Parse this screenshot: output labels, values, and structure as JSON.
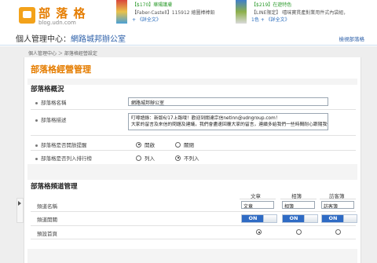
{
  "header": {
    "logo_title": "部 落 格",
    "logo_sub": "blog.udn.com",
    "ads": [
      {
        "t1": "【$170】華陽護膚",
        "t2": "【Faber-Castell】115912 繪圖棒棒鉛",
        "t3": "+ 《詳全文》"
      },
      {
        "t1": "【$219】在遊特色",
        "t2": "【LINE限定】 嘻味寶貫產對業用件式內袋組，",
        "t3": "1色 + 《詳全文》"
      }
    ]
  },
  "titlebar": {
    "prefix": "個人管理中心：",
    "office": "網路城邦辦公室",
    "right_link": "檢視部落格"
  },
  "breadcrumb": {
    "home": "個人管理中心",
    "sep": " ＞ ",
    "current": "部落格經營設定"
  },
  "page": {
    "title": "部落格經營管理"
  },
  "overview": {
    "title": "部落格概況",
    "name_label": "部落格名稱",
    "name_value": "網路城邦辦公室",
    "desc_label": "部落格描述",
    "desc_lines": [
      "叮嚀語錄：新版6/17上路哦！歡迎到關達宗信netinn@udngroup.com！",
      "大家的留言及來信的問題及建議，我們會盡速回覆大家的留言，連續多給我們一些時間耐心跟隨我們！謝謝！"
    ],
    "comment_label": "部落格是否開放提醒",
    "comment_options": [
      "開啟",
      "關閉"
    ],
    "comment_selected": 0,
    "rank_label": "部落格是否列入排行榜",
    "rank_options": [
      "列入",
      "不列入"
    ],
    "rank_selected": 1
  },
  "channel": {
    "title": "部落格頻道管理",
    "columns": [
      "文章",
      "相簿",
      "訪客簿"
    ],
    "name_label": "頻道名稱",
    "names": [
      "文章",
      "相簿",
      "訪客簿"
    ],
    "switch_label": "頻道開關",
    "switch_text": "ON",
    "home_label": "預設首頁",
    "home_selected": 0
  }
}
